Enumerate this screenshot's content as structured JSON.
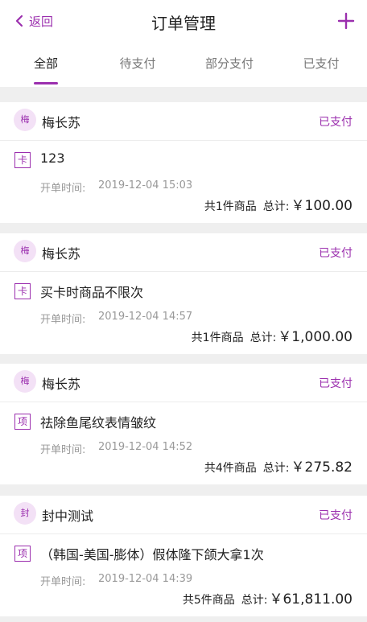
{
  "header": {
    "back_label": "返回",
    "title": "订单管理"
  },
  "tabs": [
    {
      "label": "全部",
      "active": true
    },
    {
      "label": "待支付",
      "active": false
    },
    {
      "label": "部分支付",
      "active": false
    },
    {
      "label": "已支付",
      "active": false
    }
  ],
  "labels": {
    "time_label": "开单时间:",
    "total_label": "总计:"
  },
  "orders": [
    {
      "avatar": "梅",
      "customer": "梅长苏",
      "status": "已支付",
      "item_type": "卡",
      "item_name": "123",
      "time": "2019-12-04 15:03",
      "count_text": "共1件商品",
      "total": "￥100.00"
    },
    {
      "avatar": "梅",
      "customer": "梅长苏",
      "status": "已支付",
      "item_type": "卡",
      "item_name": "买卡时商品不限次",
      "time": "2019-12-04 14:57",
      "count_text": "共1件商品",
      "total": "￥1,000.00"
    },
    {
      "avatar": "梅",
      "customer": "梅长苏",
      "status": "已支付",
      "item_type": "项",
      "item_name": "祛除鱼尾纹表情皱纹",
      "time": "2019-12-04 14:52",
      "count_text": "共4件商品",
      "total": "￥275.82"
    },
    {
      "avatar": "封",
      "customer": "封中测试",
      "status": "已支付",
      "item_type": "项",
      "item_name": "（韩国-美国-膨体）假体隆下颌大拿1次",
      "time": "2019-12-04 14:39",
      "count_text": "共5件商品",
      "total": "￥61,811.00"
    }
  ],
  "colors": {
    "accent": "#9b2fae",
    "background": "#efefef"
  }
}
